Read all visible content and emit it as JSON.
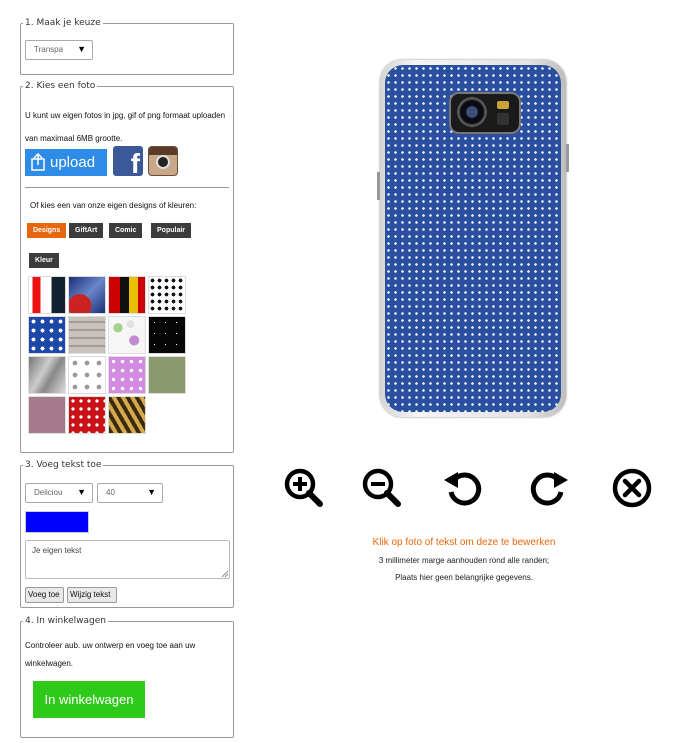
{
  "section1": {
    "legend": "1. Maak je keuze",
    "select_value": "Transpa"
  },
  "section2": {
    "legend": "2. Kies een foto",
    "intro": "U kunt uw eigen fotos in jpg, gif of png formaat uploaden van maximaal 6MB grootte.",
    "upload_label": "upload",
    "designs_intro": "Of kies een van onze eigen designs of kleuren:",
    "tabs": [
      {
        "label": "Designs",
        "active": true
      },
      {
        "label": "GiftArt",
        "active": false
      },
      {
        "label": "Comic",
        "active": false
      },
      {
        "label": "Populair",
        "active": false
      },
      {
        "label": "Kleur",
        "active": false
      }
    ]
  },
  "section3": {
    "legend": "3. Voeg tekst toe",
    "font_value": "Deliciou",
    "size_value": "40",
    "text_color": "#0000ff",
    "text_placeholder": "Je eigen tekst",
    "add_label": "Voeg toe",
    "edit_label": "Wijzig tekst"
  },
  "section4": {
    "legend": "4. In winkelwagen",
    "text": "Controleer aub. uw ontwerp en voeg toe aan uw winkelwagen.",
    "cart_label": "In winkelwagen"
  },
  "preview": {
    "hint": "Klik op foto of tekst om deze te bewerken",
    "note1": "3 millimeter marge aanhouden rond alle randen;",
    "note2": "Plaats hier geen belangrijke gegevens."
  },
  "icons": {
    "zoom_in": "zoom-in-icon",
    "zoom_out": "zoom-out-icon",
    "rotate_left": "rotate-left-icon",
    "rotate_right": "rotate-right-icon",
    "remove": "close-icon"
  },
  "colors": {
    "accent_tab": "#e8670d",
    "cart": "#2fc91a",
    "upload": "#2f8ce6",
    "hint": "#e8670d",
    "case": "#2a4f9e"
  }
}
